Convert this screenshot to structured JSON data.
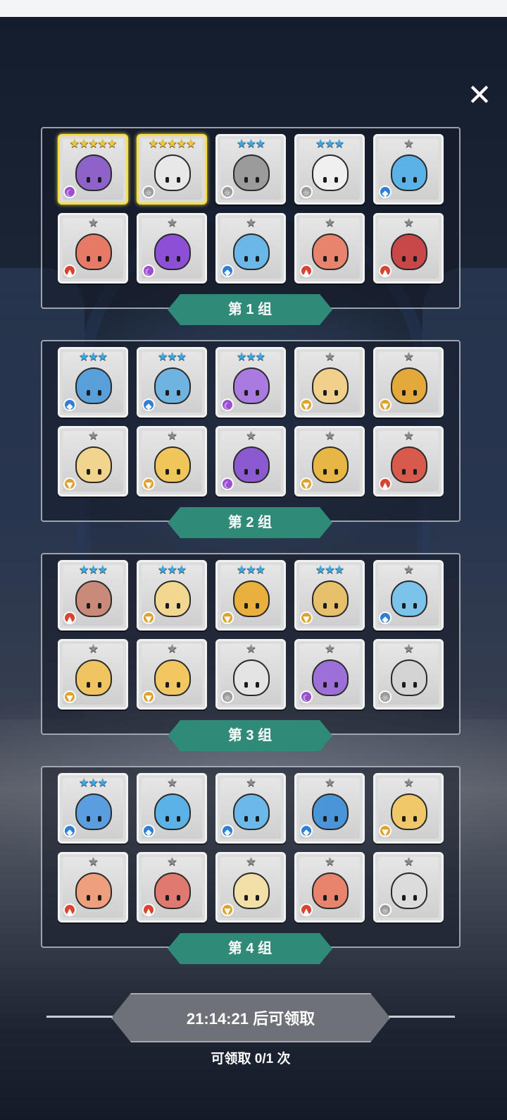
{
  "close_icon": "close-icon",
  "groups": [
    {
      "label": "第 1 组",
      "rows": [
        [
          {
            "stars": "★★★★★",
            "tier": "gold",
            "element": "dark",
            "color": "#8e63c9"
          },
          {
            "stars": "★★★★★",
            "tier": "gold",
            "element": "light",
            "color": "#e8e8e8"
          },
          {
            "stars": "★★★",
            "tier": "blue",
            "element": "light",
            "color": "#9b9b9b"
          },
          {
            "stars": "★★★",
            "tier": "blue",
            "element": "light",
            "color": "#f0f0f0"
          },
          {
            "stars": "★",
            "tier": "grey",
            "element": "water",
            "color": "#5ab2e6"
          }
        ],
        [
          {
            "stars": "★",
            "tier": "grey",
            "element": "fire",
            "color": "#e77a66"
          },
          {
            "stars": "★",
            "tier": "grey",
            "element": "dark",
            "color": "#8c4fd6"
          },
          {
            "stars": "★",
            "tier": "grey",
            "element": "water",
            "color": "#6bb7e8"
          },
          {
            "stars": "★",
            "tier": "grey",
            "element": "fire",
            "color": "#e8846e"
          },
          {
            "stars": "★",
            "tier": "grey",
            "element": "fire",
            "color": "#c8484a"
          }
        ]
      ]
    },
    {
      "label": "第 2 组",
      "rows": [
        [
          {
            "stars": "★★★",
            "tier": "blue",
            "element": "water",
            "color": "#5aa0d8"
          },
          {
            "stars": "★★★",
            "tier": "blue",
            "element": "water",
            "color": "#6fb4e0"
          },
          {
            "stars": "★★★",
            "tier": "blue",
            "element": "dark",
            "color": "#a97be0"
          },
          {
            "stars": "★",
            "tier": "grey",
            "element": "earth",
            "color": "#f0d08a"
          },
          {
            "stars": "★",
            "tier": "grey",
            "element": "earth",
            "color": "#e3a93a"
          }
        ],
        [
          {
            "stars": "★",
            "tier": "grey",
            "element": "earth",
            "color": "#f2d58c"
          },
          {
            "stars": "★",
            "tier": "grey",
            "element": "earth",
            "color": "#f0c55a"
          },
          {
            "stars": "★",
            "tier": "grey",
            "element": "dark",
            "color": "#8c5ad0"
          },
          {
            "stars": "★",
            "tier": "grey",
            "element": "earth",
            "color": "#e8b645"
          },
          {
            "stars": "★",
            "tier": "grey",
            "element": "fire",
            "color": "#d85a4c"
          }
        ]
      ]
    },
    {
      "label": "第 3 组",
      "rows": [
        [
          {
            "stars": "★★★",
            "tier": "blue",
            "element": "fire",
            "color": "#c98a7a"
          },
          {
            "stars": "★★★",
            "tier": "blue",
            "element": "earth",
            "color": "#f2d78e"
          },
          {
            "stars": "★★★",
            "tier": "blue",
            "element": "earth",
            "color": "#e9b03e"
          },
          {
            "stars": "★★★",
            "tier": "blue",
            "element": "earth",
            "color": "#e6c06a"
          },
          {
            "stars": "★",
            "tier": "grey",
            "element": "water",
            "color": "#7bc3e8"
          }
        ],
        [
          {
            "stars": "★",
            "tier": "grey",
            "element": "earth",
            "color": "#f0c460"
          },
          {
            "stars": "★",
            "tier": "grey",
            "element": "earth",
            "color": "#f2c660"
          },
          {
            "stars": "★",
            "tier": "grey",
            "element": "light",
            "color": "#e4e4e4"
          },
          {
            "stars": "★",
            "tier": "grey",
            "element": "dark",
            "color": "#9d6fd8"
          },
          {
            "stars": "★",
            "tier": "grey",
            "element": "light",
            "color": "#d4d4d4"
          }
        ]
      ]
    },
    {
      "label": "第 4 组",
      "rows": [
        [
          {
            "stars": "★★★",
            "tier": "blue",
            "element": "water",
            "color": "#5a9ee0"
          },
          {
            "stars": "★",
            "tier": "grey",
            "element": "water",
            "color": "#5ab2e6"
          },
          {
            "stars": "★",
            "tier": "grey",
            "element": "water",
            "color": "#6cb8ea"
          },
          {
            "stars": "★",
            "tier": "grey",
            "element": "water",
            "color": "#4a94d8"
          },
          {
            "stars": "★",
            "tier": "grey",
            "element": "earth",
            "color": "#f0c86a"
          }
        ],
        [
          {
            "stars": "★",
            "tier": "grey",
            "element": "fire",
            "color": "#eea07e"
          },
          {
            "stars": "★",
            "tier": "grey",
            "element": "fire",
            "color": "#e07a70"
          },
          {
            "stars": "★",
            "tier": "grey",
            "element": "earth",
            "color": "#f3e0a8"
          },
          {
            "stars": "★",
            "tier": "grey",
            "element": "fire",
            "color": "#e8846e"
          },
          {
            "stars": "★",
            "tier": "grey",
            "element": "light",
            "color": "#dcdcdc"
          }
        ]
      ]
    }
  ],
  "claim": {
    "button_label": "21:14:21 后可领取",
    "count_label": "可领取 0/1 次"
  }
}
